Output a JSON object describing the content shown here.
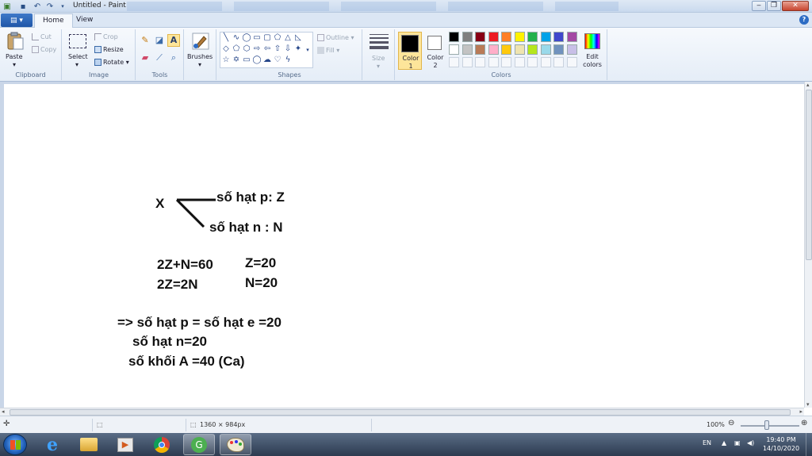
{
  "window": {
    "title": "Untitled - Paint",
    "controls": {
      "minimize": "‒",
      "maximize": "❐",
      "close": "✕"
    }
  },
  "tabs": {
    "file": "▤ ▾",
    "home": "Home",
    "view": "View"
  },
  "ribbon": {
    "clipboard": {
      "label": "Clipboard",
      "paste": "Paste",
      "cut": "Cut",
      "copy": "Copy"
    },
    "image": {
      "label": "Image",
      "select": "Select",
      "crop": "Crop",
      "resize": "Resize",
      "rotate": "Rotate"
    },
    "tools": {
      "label": "Tools"
    },
    "brushes": {
      "label": "Brushes"
    },
    "shapes": {
      "label": "Shapes",
      "outline": "Outline",
      "fill": "Fill"
    },
    "size": {
      "label": "Size"
    },
    "colors": {
      "label": "Colors",
      "color1": "Color\n1",
      "color2": "Color\n2",
      "edit": "Edit\ncolors",
      "color1_value": "#000000",
      "color2_value": "#ffffff",
      "palette_row1": [
        "#000000",
        "#7f7f7f",
        "#880015",
        "#ed1c24",
        "#ff7f27",
        "#fff200",
        "#22b14c",
        "#00a2e8",
        "#3f48cc",
        "#a349a4"
      ],
      "palette_row2": [
        "#ffffff",
        "#c3c3c3",
        "#b97a57",
        "#ffaec9",
        "#ffc90e",
        "#efe4b0",
        "#b5e61d",
        "#99d9ea",
        "#7092be",
        "#c8bfe7"
      ]
    }
  },
  "canvas_text": {
    "x_label": "X",
    "line_p": "số hạt p: Z",
    "line_n": "số hạt n : N",
    "eq1": "2Z+N=60",
    "eq2": "2Z=2N",
    "res1": "Z=20",
    "res2": "N=20",
    "concl1": "=> số hạt p = số hạt e =20",
    "concl2": "số hạt n=20",
    "concl3": "số khối A =40 (Ca)"
  },
  "statusbar": {
    "canvas_size": "1360 × 984px",
    "zoom": "100%"
  },
  "taskbar": {
    "lang": "EN",
    "time": "19:40 PM",
    "date": "14/10/2020"
  }
}
